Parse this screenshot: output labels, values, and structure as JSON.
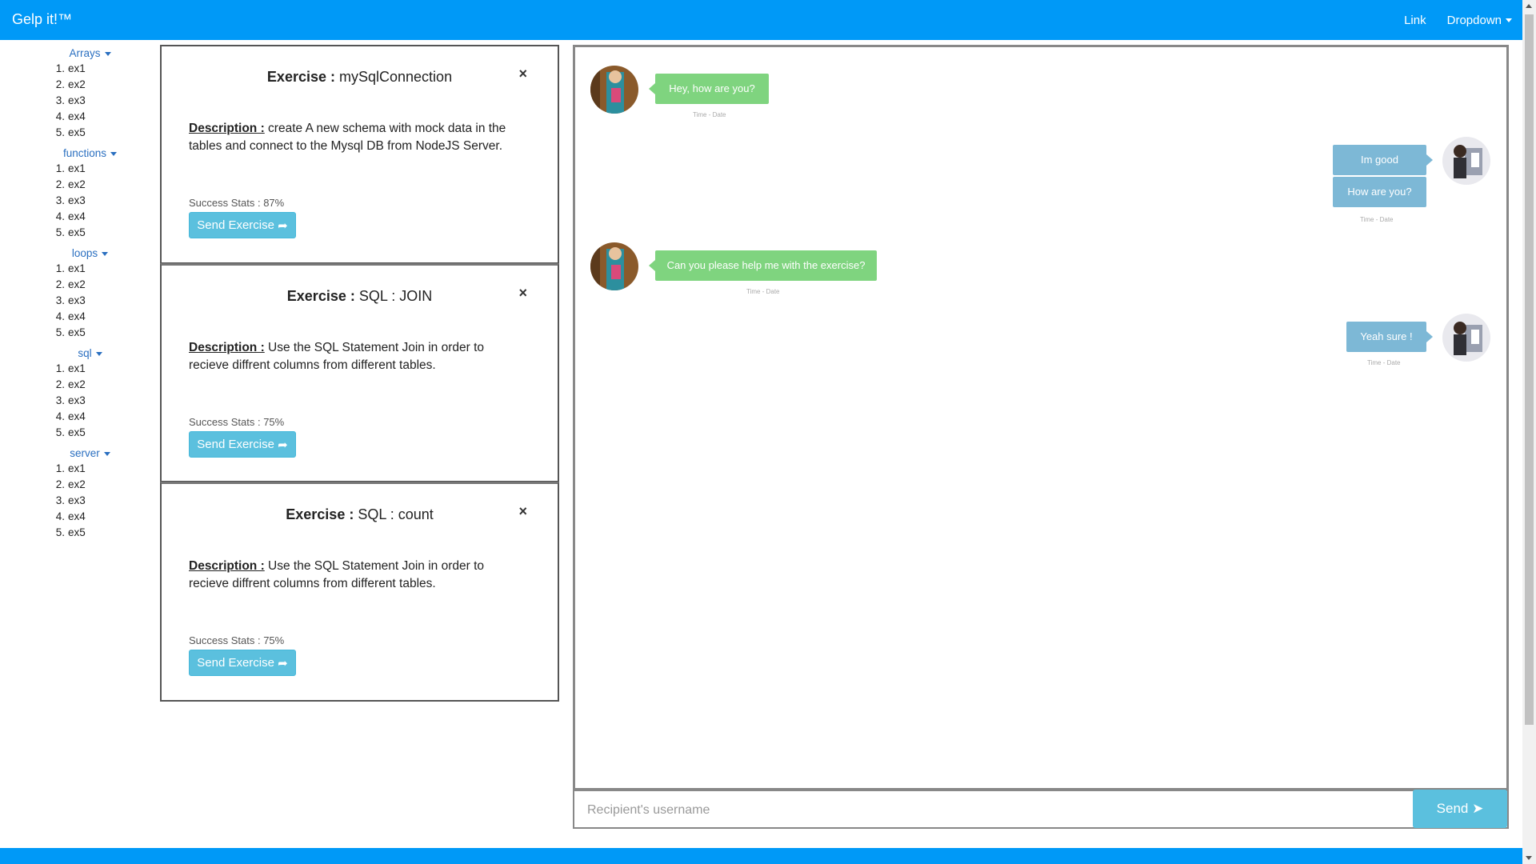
{
  "navbar": {
    "brand": "Gelp it!™",
    "link": "Link",
    "dropdown": "Dropdown"
  },
  "sidebar": {
    "categories": [
      {
        "label": "Arrays",
        "items": [
          "ex1",
          "ex2",
          "ex3",
          "ex4",
          "ex5"
        ]
      },
      {
        "label": "functions",
        "items": [
          "ex1",
          "ex2",
          "ex3",
          "ex4",
          "ex5"
        ]
      },
      {
        "label": "loops",
        "items": [
          "ex1",
          "ex2",
          "ex3",
          "ex4",
          "ex5"
        ]
      },
      {
        "label": "sql",
        "items": [
          "ex1",
          "ex2",
          "ex3",
          "ex4",
          "ex5"
        ]
      },
      {
        "label": "server",
        "items": [
          "ex1",
          "ex2",
          "ex3",
          "ex4",
          "ex5"
        ]
      }
    ]
  },
  "exercises": [
    {
      "title_label": "Exercise :",
      "title_value": "mySqlConnection",
      "desc_label": "Description :",
      "desc_text": "create A new schema with mock data in the tables and connect to the Mysql DB from NodeJS Server.",
      "stats": "Success Stats : 87%",
      "button": "Send Exercise",
      "close": "×"
    },
    {
      "title_label": "Exercise :",
      "title_value": "SQL : JOIN",
      "desc_label": "Description :",
      "desc_text": "Use the SQL Statement Join in order to recieve diffrent columns from different tables.",
      "stats": "Success Stats : 75%",
      "button": "Send Exercise",
      "close": "×"
    },
    {
      "title_label": "Exercise :",
      "title_value": "SQL : count",
      "desc_label": "Description :",
      "desc_text": "Use the SQL Statement Join in order to recieve diffrent columns from different tables.",
      "stats": "Success Stats : 75%",
      "button": "Send Exercise",
      "close": "×"
    }
  ],
  "chat": {
    "messages": [
      {
        "dir": "in",
        "text": "Hey, how are you?",
        "stamp": "Time - Date"
      },
      {
        "dir": "out",
        "text": "Im good",
        "stamp": ""
      },
      {
        "dir": "out",
        "text": "How are you?",
        "stamp": "Time - Date"
      },
      {
        "dir": "in",
        "text": "Can you please help me with the exercise?",
        "stamp": "Time - Date"
      },
      {
        "dir": "out",
        "text": "Yeah sure !",
        "stamp": "Time - Date"
      }
    ],
    "input_placeholder": "Recipient's username",
    "send_label": "Send"
  },
  "colors": {
    "navbar": "#0099f7",
    "bubble_in": "#7fd47f",
    "bubble_out": "#7db8d6",
    "button": "#5bc0de"
  }
}
